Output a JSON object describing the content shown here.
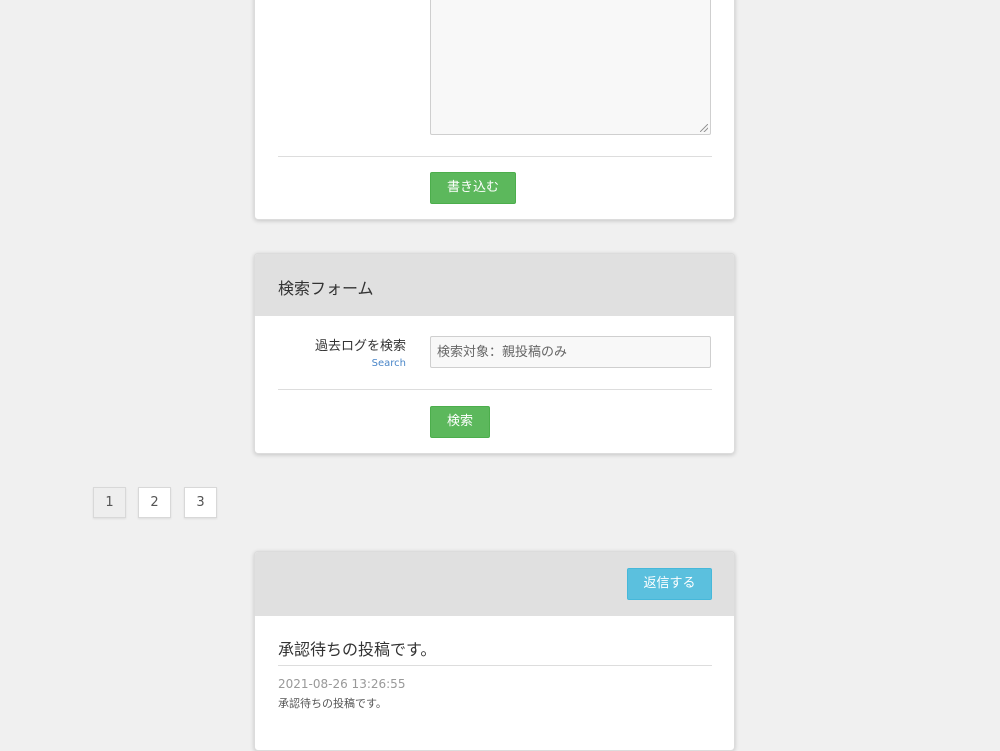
{
  "post_form": {
    "submit_label": "書き込む"
  },
  "search_form": {
    "title": "検索フォーム",
    "field_label": "過去ログを検索",
    "field_sublabel": "Search",
    "input_placeholder": "検索対象：親投稿のみ",
    "input_value": "",
    "submit_label": "検索"
  },
  "pagination": {
    "pages": [
      "1",
      "2",
      "3"
    ],
    "current": "1"
  },
  "thread": {
    "reply_label": "返信する",
    "title": "承認待ちの投稿です。",
    "date": "2021-08-26 13:26:55",
    "body": "承認待ちの投稿です。"
  },
  "colors": {
    "page_background": "#f0f0f0",
    "panel_heading": "#e0e0e0",
    "button_green": "#5cb85c",
    "button_blue": "#5bc0de",
    "link_blue": "#4a86c8"
  },
  "icons": {
    "textarea_resize": "resize-grip-icon"
  }
}
